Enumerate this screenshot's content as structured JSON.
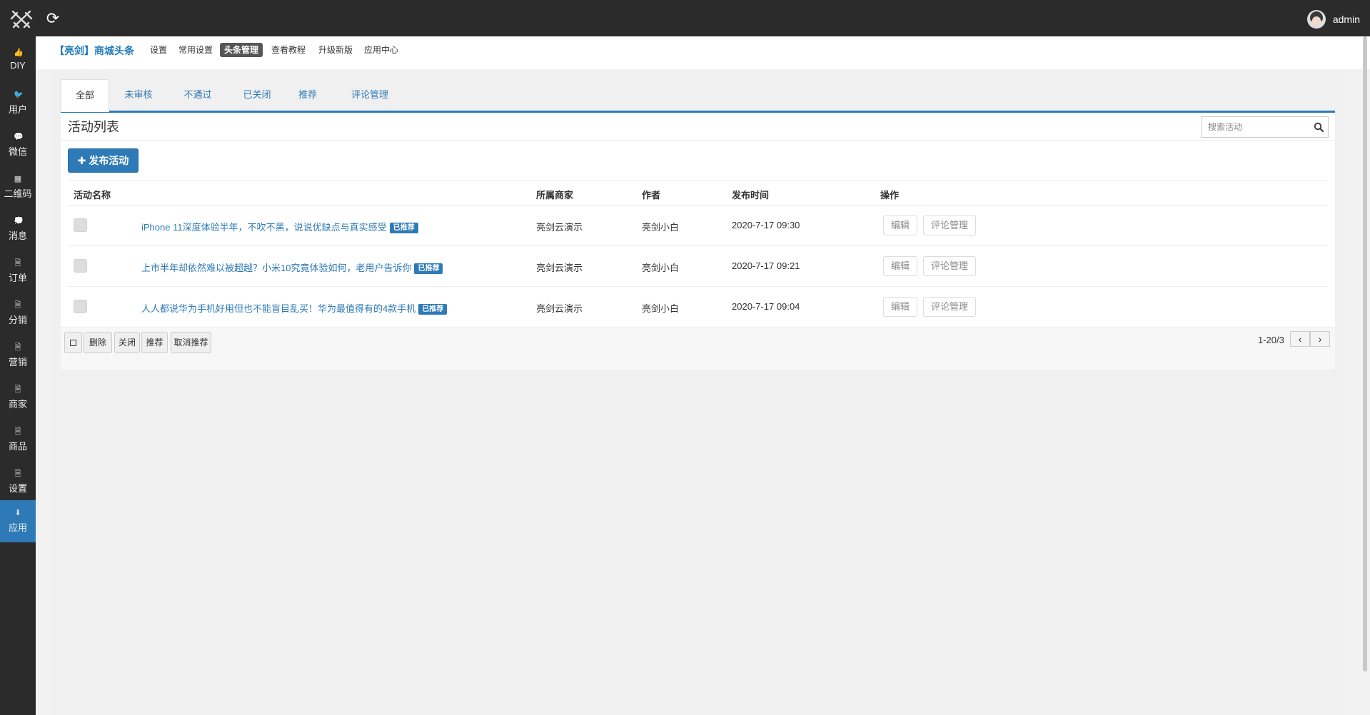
{
  "topbar": {
    "logo_icon": "crossed-swords-logo",
    "refresh_icon": "refresh-icon",
    "user_name": "admin"
  },
  "sidebar": {
    "items": [
      {
        "label": "DIY",
        "icon": "thumbs-up-icon",
        "glyph": "👍"
      },
      {
        "label": "用户",
        "icon": "twitter-icon",
        "glyph": "🐦"
      },
      {
        "label": "微信",
        "icon": "wechat-icon",
        "glyph": "💬"
      },
      {
        "label": "二维码",
        "icon": "qrcode-icon",
        "glyph": "▦"
      },
      {
        "label": "消息",
        "icon": "message-icon",
        "glyph": "💭"
      },
      {
        "label": "订单",
        "icon": "document-icon",
        "glyph": "🗎"
      },
      {
        "label": "分销",
        "icon": "document-icon",
        "glyph": "🗎"
      },
      {
        "label": "营销",
        "icon": "document-icon",
        "glyph": "🗎"
      },
      {
        "label": "商家",
        "icon": "document-icon",
        "glyph": "🗎"
      },
      {
        "label": "商品",
        "icon": "document-icon",
        "glyph": "🗎"
      },
      {
        "label": "设置",
        "icon": "document-icon",
        "glyph": "🗎"
      },
      {
        "label": "应用",
        "icon": "download-icon",
        "glyph": "⬇"
      }
    ],
    "active_index": 11
  },
  "subnav": {
    "brand": "【亮剑】商城头条",
    "links": [
      "设置",
      "常用设置",
      "头条管理",
      "查看教程",
      "升级新版",
      "应用中心"
    ],
    "active_index": 2
  },
  "tabs": {
    "items": [
      "全部",
      "未审核",
      "不通过",
      "已关闭",
      "推荐",
      "评论管理"
    ],
    "active_index": 0
  },
  "list": {
    "title": "活动列表",
    "search_placeholder": "搜索活动",
    "publish_label": "发布活动",
    "columns": [
      "活动名称",
      "所属商家",
      "作者",
      "发布时间",
      "操作"
    ],
    "rows": [
      {
        "title": "iPhone 11深度体验半年，不吹不黑，说说优缺点与真实感受",
        "badge": "已推荐",
        "merchant": "亮剑云演示",
        "author": "亮剑小白",
        "time": "2020-7-17 09:30",
        "edit": "编辑",
        "comments": "评论管理"
      },
      {
        "title": "上市半年却依然难以被超越？小米10究竟体验如何，老用户告诉你",
        "badge": "已推荐",
        "merchant": "亮剑云演示",
        "author": "亮剑小白",
        "time": "2020-7-17 09:21",
        "edit": "编辑",
        "comments": "评论管理"
      },
      {
        "title": "人人都说华为手机好用但也不能盲目乱买！华为最值得有的4款手机",
        "badge": "已推荐",
        "merchant": "亮剑云演示",
        "author": "亮剑小白",
        "time": "2020-7-17 09:04",
        "edit": "编辑",
        "comments": "评论管理"
      }
    ]
  },
  "footer": {
    "delete": "删除",
    "close": "关闭",
    "recommend": "推荐",
    "unrecommend": "取消推荐",
    "pager": "1-20/3"
  },
  "colors": {
    "topbar": "#2b2b2b",
    "accent": "#2d7ab7",
    "page_bg": "#f0f0f0"
  }
}
